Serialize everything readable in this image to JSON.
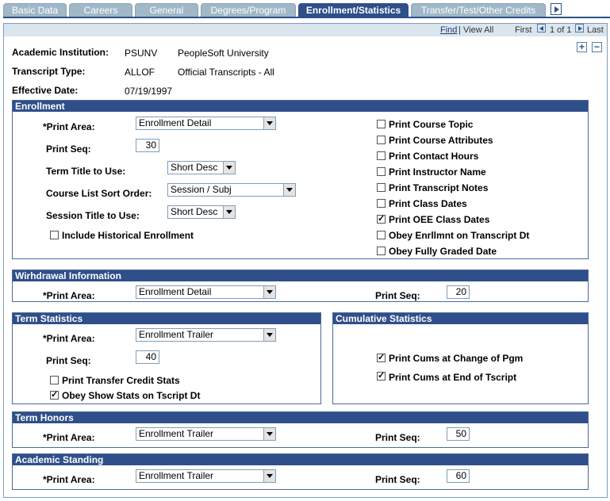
{
  "tabs": [
    "Basic Data",
    "Careers",
    "General",
    "Degrees/Program",
    "Enrollment/Statistics",
    "Transfer/Test/Other Credits"
  ],
  "nav": {
    "find": "Find",
    "view_all": "View All",
    "first": "First",
    "count": "1 of 1",
    "last": "Last"
  },
  "header": {
    "institution_label": "Academic Institution:",
    "institution_code": "PSUNV",
    "institution_name": "PeopleSoft University",
    "transcript_label": "Transcript Type:",
    "transcript_code": "ALLOF",
    "transcript_name": "Official Transcripts - All",
    "effdate_label": "Effective Date:",
    "effdate_value": "07/19/1997"
  },
  "enrollment": {
    "title": "Enrollment",
    "print_area_label": "*Print Area:",
    "print_area_value": "Enrollment Detail",
    "print_seq_label": "Print Seq:",
    "print_seq_value": "30",
    "term_title_label": "Term Title to Use:",
    "term_title_value": "Short Desc",
    "sort_label": "Course List Sort Order:",
    "sort_value": "Session / Subj",
    "session_title_label": "Session Title to Use:",
    "session_title_value": "Short Desc",
    "historical_label": "Include Historical Enrollment",
    "checks": [
      {
        "label": "Print Course Topic",
        "checked": false
      },
      {
        "label": "Print Course Attributes",
        "checked": false
      },
      {
        "label": "Print Contact Hours",
        "checked": false
      },
      {
        "label": "Print Instructor Name",
        "checked": false
      },
      {
        "label": "Print Transcript Notes",
        "checked": false
      },
      {
        "label": "Print Class Dates",
        "checked": false
      },
      {
        "label": "Print OEE Class Dates",
        "checked": true
      },
      {
        "label": "Obey Enrllmnt on Transcript Dt",
        "checked": false
      },
      {
        "label": "Obey Fully Graded Date",
        "checked": false
      }
    ]
  },
  "withdrawal": {
    "title": "Wirhdrawal Information",
    "print_area_label": "*Print Area:",
    "print_area_value": "Enrollment Detail",
    "print_seq_label": "Print Seq:",
    "print_seq_value": "20"
  },
  "term_stats": {
    "title": "Term Statistics",
    "print_area_label": "*Print Area:",
    "print_area_value": "Enrollment Trailer",
    "print_seq_label": "Print Seq:",
    "print_seq_value": "40",
    "transfer_label": "Print Transfer Credit Stats",
    "obey_label": "Obey Show Stats on Tscript Dt"
  },
  "cum_stats": {
    "title": "Cumulative Statistics",
    "change_label": "Print Cums at Change of Pgm",
    "end_label": "Print Cums at End of Tscript"
  },
  "term_honors": {
    "title": "Term Honors",
    "print_area_label": "*Print Area:",
    "print_area_value": "Enrollment Trailer",
    "print_seq_label": "Print Seq:",
    "print_seq_value": "50"
  },
  "academic_standing": {
    "title": "Academic Standing",
    "print_area_label": "*Print Area:",
    "print_area_value": "Enrollment Trailer",
    "print_seq_label": "Print Seq:",
    "print_seq_value": "60"
  }
}
